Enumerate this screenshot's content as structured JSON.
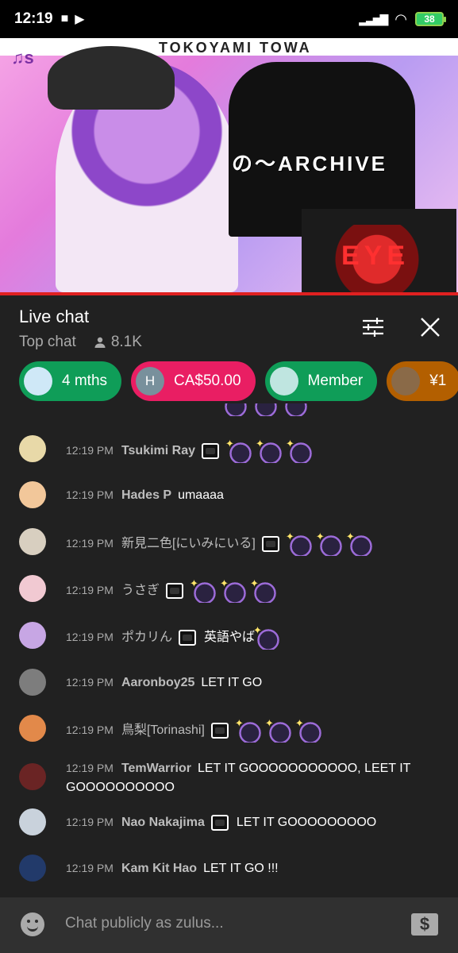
{
  "status_bar": {
    "time": "12:19",
    "battery": "38"
  },
  "video": {
    "banner_text": "TOKOYAMI TOWA",
    "logo_text": "♫s",
    "overlay_text": "の〜ARCHIVE",
    "red_text": "EYE"
  },
  "chat_header": {
    "title": "Live chat",
    "mode": "Top chat",
    "viewers": "8.1K"
  },
  "tickers": [
    {
      "label": "4 mths",
      "color": "#0f9d58",
      "avatar": ""
    },
    {
      "label": "CA$50.00",
      "color": "#e91e63",
      "avatar": "H"
    },
    {
      "label": "Member",
      "color": "#0f9d58",
      "avatar": ""
    },
    {
      "label": "¥1",
      "color": "#b35f00",
      "avatar": ""
    }
  ],
  "messages": [
    {
      "time": "12:19 PM",
      "author": "Tsukimi Ray",
      "text": "",
      "badge": true,
      "emotes": 3,
      "avatar_color": "#e8d9a8"
    },
    {
      "time": "12:19 PM",
      "author": "Hades P",
      "text": "umaaaa",
      "badge": false,
      "emotes": 0,
      "avatar_color": "#f2c79a"
    },
    {
      "time": "12:19 PM",
      "author": "新見二色[にいみにいる]",
      "text": "",
      "badge": true,
      "emotes": 3,
      "avatar_color": "#d8cfc0"
    },
    {
      "time": "12:19 PM",
      "author": "うさぎ",
      "text": "",
      "badge": true,
      "emotes": 3,
      "avatar_color": "#f1c9d2"
    },
    {
      "time": "12:19 PM",
      "author": "ポカリん",
      "text": "英語やば",
      "badge": true,
      "emotes": 1,
      "avatar_color": "#c7a6e4"
    },
    {
      "time": "12:19 PM",
      "author": "Aaronboy25",
      "text": "LET IT GO",
      "badge": false,
      "emotes": 0,
      "avatar_color": "#7d7d7d"
    },
    {
      "time": "12:19 PM",
      "author": "鳥梨[Torinashi]",
      "text": "",
      "badge": true,
      "emotes": 3,
      "avatar_color": "#e2894a"
    },
    {
      "time": "12:19 PM",
      "author": "TemWarrior",
      "text": "LET IT GOOOOOOOOOOO, LEET IT GOOOOOOOOOO",
      "badge": false,
      "emotes": 0,
      "avatar_color": "#6a2424"
    },
    {
      "time": "12:19 PM",
      "author": "Nao Nakajima",
      "text": "LET IT GOOOOOOOOO",
      "badge": true,
      "emotes": 0,
      "avatar_color": "#c9d2dc"
    },
    {
      "time": "12:19 PM",
      "author": "Kam Kit Hao",
      "text": "LET IT GO !!!",
      "badge": false,
      "emotes": 0,
      "avatar_color": "#223a6a"
    }
  ],
  "input": {
    "placeholder": "Chat publicly as zulus..."
  }
}
